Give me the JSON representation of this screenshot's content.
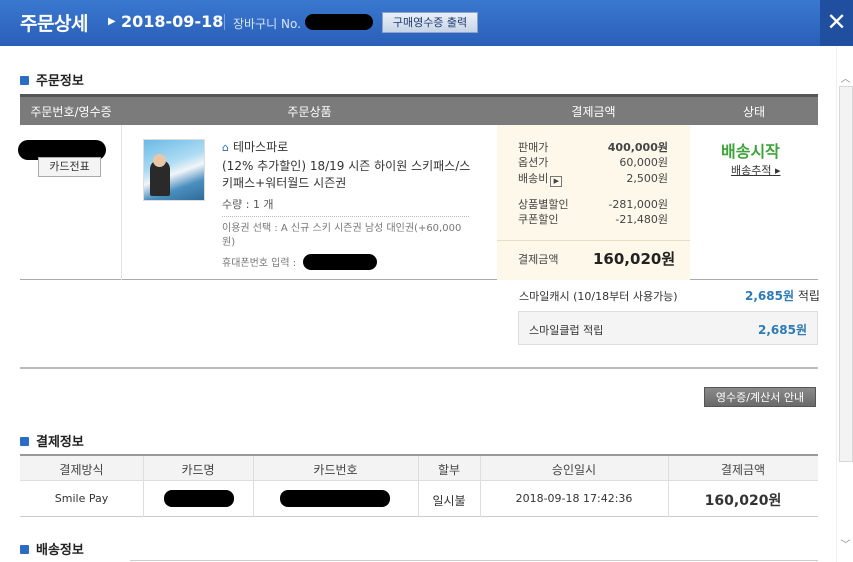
{
  "header": {
    "title": "주문상세",
    "date": "2018-09-18",
    "cart_label": "장바구니 No.",
    "receipt_button": "구매영수증 출력",
    "close": "✕"
  },
  "sections": {
    "order_info": "주문정보",
    "payment_info": "결제정보",
    "delivery_info": "배송정보"
  },
  "order_table": {
    "headers": [
      "주문번호/영수증",
      "주문상품",
      "결제금액",
      "상태"
    ],
    "ticket_button": "카드전표",
    "shop_name": "테마스파로",
    "product_name": "(12% 추가할인) 18/19 시즌 하이원 스키패스/스키패스+워터월드 시즌권",
    "quantity": "수량 : 1 개",
    "option": "이용권 선택 : A 신규 스키 시즌권 남성 대인권(+60,000원)",
    "phone_label": "휴대폰번호 입력 :",
    "payment": {
      "rows": [
        {
          "label": "판매가",
          "value": "400,000원",
          "bold": true
        },
        {
          "label": "옵션가",
          "value": "60,000원"
        },
        {
          "label": "배송비",
          "value": "2,500원"
        },
        {
          "label": "상품별할인",
          "value": "-281,000원"
        },
        {
          "label": "쿠폰할인",
          "value": "-21,480원"
        }
      ],
      "mini_button": "▶",
      "total_label": "결제금액",
      "total_value": "160,020원"
    },
    "status": "배송시작",
    "track_link": "배송추적 ▸"
  },
  "smile": {
    "cash_label": "스마일캐시 (10/18부터 사용가능)",
    "cash_value": "2,685원",
    "cash_suffix": " 적립",
    "club_label": "스마일클럽 적립",
    "club_value": "2,685원"
  },
  "guide_button": "영수증/계산서 안내",
  "payment_table": {
    "headers": [
      "결제방식",
      "카드명",
      "카드번호",
      "할부",
      "승인일시",
      "결제금액"
    ],
    "row": {
      "method": "Smile Pay",
      "installment": "일시불",
      "approved_at": "2018-09-18 17:42:36",
      "amount": "160,020원"
    }
  },
  "colors": {
    "header": "#2a5fb8",
    "accent_blue": "#2d7ab5",
    "status_green": "#3ea33a"
  }
}
